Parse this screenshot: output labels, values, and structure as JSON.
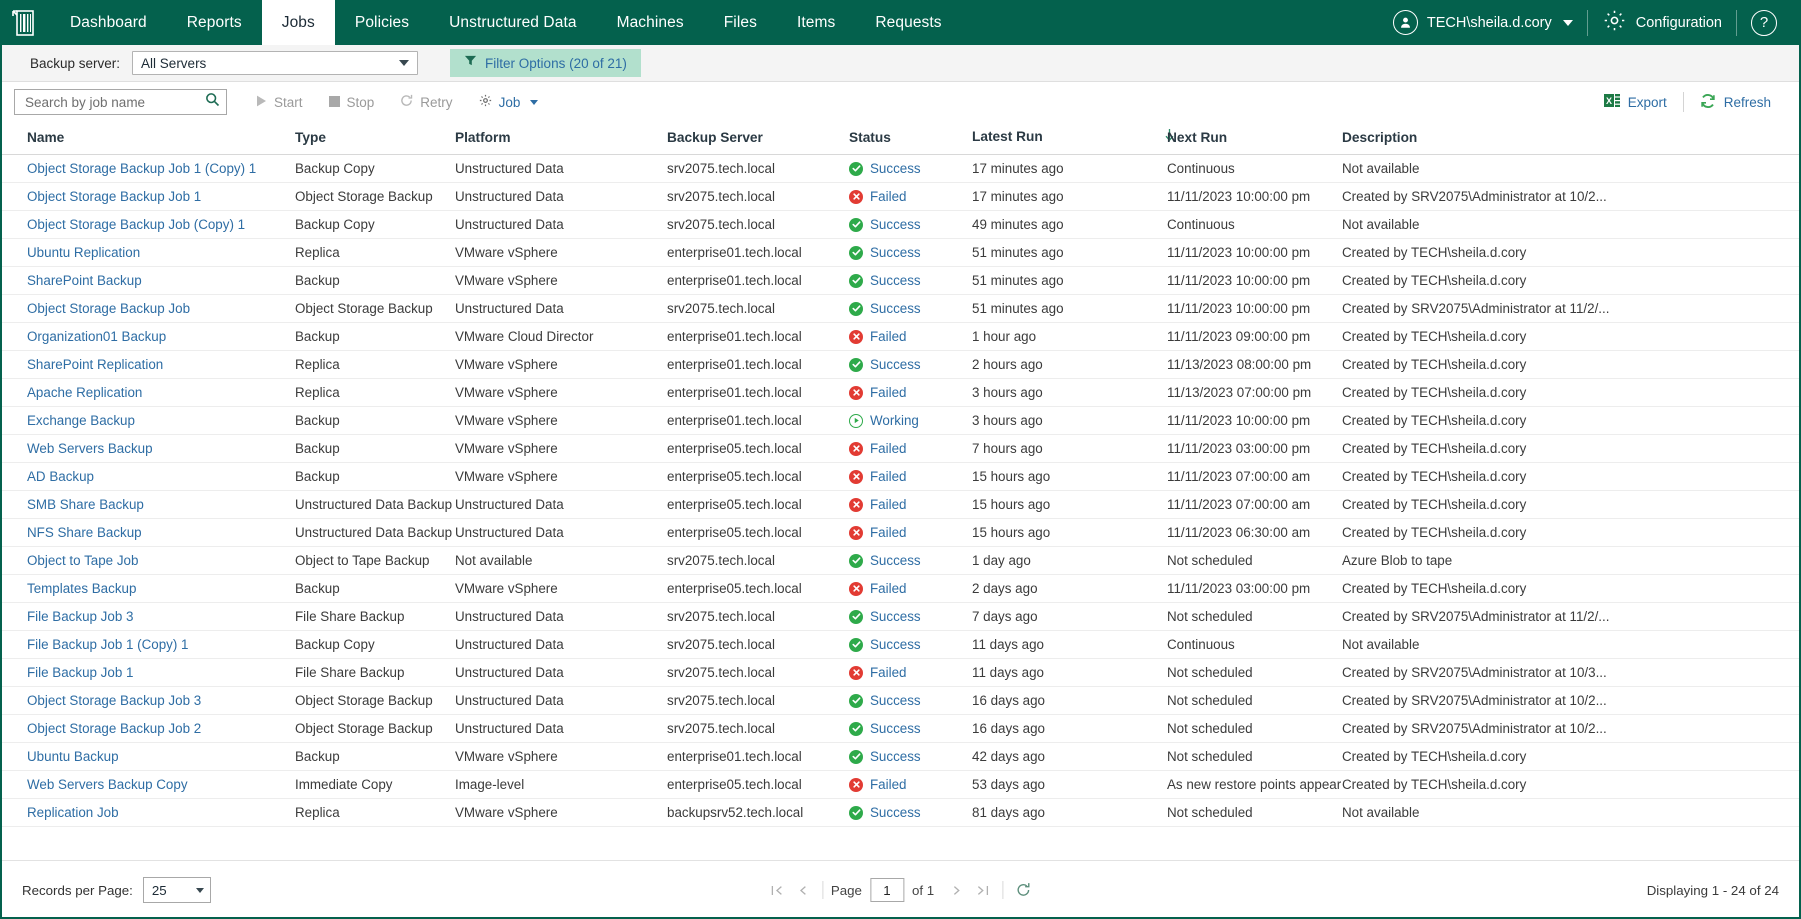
{
  "header": {
    "logo_icon": "barcode-building-icon",
    "nav": [
      {
        "label": "Dashboard",
        "active": false
      },
      {
        "label": "Reports",
        "active": false
      },
      {
        "label": "Jobs",
        "active": true
      },
      {
        "label": "Policies",
        "active": false
      },
      {
        "label": "Unstructured Data",
        "active": false
      },
      {
        "label": "Machines",
        "active": false
      },
      {
        "label": "Files",
        "active": false
      },
      {
        "label": "Items",
        "active": false
      },
      {
        "label": "Requests",
        "active": false
      }
    ],
    "user": "TECH\\sheila.d.cory",
    "configuration": "Configuration",
    "help": "?",
    "accent": "#04614d"
  },
  "filterbar": {
    "backup_server_label": "Backup server:",
    "backup_server_value": "All Servers",
    "filter_options_label": "Filter Options (20 of 21)",
    "filter_chip_bg": "#b2e0cd"
  },
  "actionbar": {
    "search_placeholder": "Search by job name",
    "search_value": "",
    "start": "Start",
    "stop": "Stop",
    "retry": "Retry",
    "job": "Job",
    "export": "Export",
    "refresh": "Refresh"
  },
  "table": {
    "columns": [
      {
        "key": "name",
        "label": "Name"
      },
      {
        "key": "type",
        "label": "Type"
      },
      {
        "key": "platform",
        "label": "Platform"
      },
      {
        "key": "backup_server",
        "label": "Backup Server"
      },
      {
        "key": "status",
        "label": "Status"
      },
      {
        "key": "latest_run",
        "label": "Latest Run"
      },
      {
        "key": "next_run",
        "label": "Next Run"
      },
      {
        "key": "description",
        "label": "Description"
      }
    ],
    "sorted_column": "latest_run",
    "sort_direction": "desc",
    "rows": [
      {
        "name": "Object Storage Backup Job 1 (Copy) 1",
        "type": "Backup Copy",
        "platform": "Unstructured Data",
        "backup_server": "srv2075.tech.local",
        "status": "Success",
        "latest_run": "17 minutes ago",
        "next_run": "Continuous",
        "description": "Not available",
        "desc_muted": true,
        "platform_muted": false
      },
      {
        "name": "Object Storage Backup Job 1",
        "type": "Object Storage Backup",
        "platform": "Unstructured Data",
        "backup_server": "srv2075.tech.local",
        "status": "Failed",
        "latest_run": "17 minutes ago",
        "next_run": "11/11/2023 10:00:00 pm",
        "description": "Created by SRV2075\\Administrator at 10/2...",
        "desc_muted": false,
        "platform_muted": false
      },
      {
        "name": "Object Storage Backup Job (Copy) 1",
        "type": "Backup Copy",
        "platform": "Unstructured Data",
        "backup_server": "srv2075.tech.local",
        "status": "Success",
        "latest_run": "49 minutes ago",
        "next_run": "Continuous",
        "description": "Not available",
        "desc_muted": true,
        "platform_muted": false
      },
      {
        "name": "Ubuntu Replication",
        "type": "Replica",
        "platform": "VMware vSphere",
        "backup_server": "enterprise01.tech.local",
        "status": "Success",
        "latest_run": "51 minutes ago",
        "next_run": "11/11/2023 10:00:00 pm",
        "description": "Created by TECH\\sheila.d.cory",
        "desc_muted": false,
        "platform_muted": false
      },
      {
        "name": "SharePoint Backup",
        "type": "Backup",
        "platform": "VMware vSphere",
        "backup_server": "enterprise01.tech.local",
        "status": "Success",
        "latest_run": "51 minutes ago",
        "next_run": "11/11/2023 10:00:00 pm",
        "description": "Created by TECH\\sheila.d.cory",
        "desc_muted": false,
        "platform_muted": false
      },
      {
        "name": "Object Storage Backup Job",
        "type": "Object Storage Backup",
        "platform": "Unstructured Data",
        "backup_server": "srv2075.tech.local",
        "status": "Success",
        "latest_run": "51 minutes ago",
        "next_run": "11/11/2023 10:00:00 pm",
        "description": "Created by SRV2075\\Administrator at 11/2/...",
        "desc_muted": false,
        "platform_muted": false
      },
      {
        "name": "Organization01 Backup",
        "type": "Backup",
        "platform": "VMware Cloud Director",
        "backup_server": "enterprise01.tech.local",
        "status": "Failed",
        "latest_run": "1 hour ago",
        "next_run": "11/11/2023 09:00:00 pm",
        "description": "Created by TECH\\sheila.d.cory",
        "desc_muted": false,
        "platform_muted": false
      },
      {
        "name": "SharePoint Replication",
        "type": "Replica",
        "platform": "VMware vSphere",
        "backup_server": "enterprise01.tech.local",
        "status": "Success",
        "latest_run": "2 hours ago",
        "next_run": "11/13/2023 08:00:00 pm",
        "description": "Created by TECH\\sheila.d.cory",
        "desc_muted": false,
        "platform_muted": false
      },
      {
        "name": "Apache Replication",
        "type": "Replica",
        "platform": "VMware vSphere",
        "backup_server": "enterprise01.tech.local",
        "status": "Failed",
        "latest_run": "3 hours ago",
        "next_run": "11/13/2023 07:00:00 pm",
        "description": "Created by TECH\\sheila.d.cory",
        "desc_muted": false,
        "platform_muted": false
      },
      {
        "name": "Exchange Backup",
        "type": "Backup",
        "platform": "VMware vSphere",
        "backup_server": "enterprise01.tech.local",
        "status": "Working",
        "latest_run": "3 hours ago",
        "next_run": "11/11/2023 10:00:00 pm",
        "description": "Created by TECH\\sheila.d.cory",
        "desc_muted": false,
        "platform_muted": false
      },
      {
        "name": "Web Servers Backup",
        "type": "Backup",
        "platform": "VMware vSphere",
        "backup_server": "enterprise05.tech.local",
        "status": "Failed",
        "latest_run": "7 hours ago",
        "next_run": "11/11/2023 03:00:00 pm",
        "description": "Created by TECH\\sheila.d.cory",
        "desc_muted": false,
        "platform_muted": false
      },
      {
        "name": "AD Backup",
        "type": "Backup",
        "platform": "VMware vSphere",
        "backup_server": "enterprise05.tech.local",
        "status": "Failed",
        "latest_run": "15 hours ago",
        "next_run": "11/11/2023 07:00:00 am",
        "description": "Created by TECH\\sheila.d.cory",
        "desc_muted": false,
        "platform_muted": false
      },
      {
        "name": "SMB Share Backup",
        "type": "Unstructured Data Backup",
        "platform": "Unstructured Data",
        "backup_server": "enterprise05.tech.local",
        "status": "Failed",
        "latest_run": "15 hours ago",
        "next_run": "11/11/2023 07:00:00 am",
        "description": "Created by TECH\\sheila.d.cory",
        "desc_muted": false,
        "platform_muted": false
      },
      {
        "name": "NFS Share Backup",
        "type": "Unstructured Data Backup",
        "platform": "Unstructured Data",
        "backup_server": "enterprise05.tech.local",
        "status": "Failed",
        "latest_run": "15 hours ago",
        "next_run": "11/11/2023 06:30:00 am",
        "description": "Created by TECH\\sheila.d.cory",
        "desc_muted": false,
        "platform_muted": false
      },
      {
        "name": "Object to Tape Job",
        "type": "Object to Tape Backup",
        "platform": "Not available",
        "backup_server": "srv2075.tech.local",
        "status": "Success",
        "latest_run": "1 day ago",
        "next_run": "Not scheduled",
        "description": "Azure Blob to tape",
        "desc_muted": false,
        "platform_muted": true
      },
      {
        "name": "Templates Backup",
        "type": "Backup",
        "platform": "VMware vSphere",
        "backup_server": "enterprise05.tech.local",
        "status": "Failed",
        "latest_run": "2 days ago",
        "next_run": "11/11/2023 03:00:00 pm",
        "description": "Created by TECH\\sheila.d.cory",
        "desc_muted": false,
        "platform_muted": false
      },
      {
        "name": "File Backup Job 3",
        "type": "File Share Backup",
        "platform": "Unstructured Data",
        "backup_server": "srv2075.tech.local",
        "status": "Success",
        "latest_run": "7 days ago",
        "next_run": "Not scheduled",
        "description": "Created by SRV2075\\Administrator at 11/2/...",
        "desc_muted": false,
        "platform_muted": false
      },
      {
        "name": "File Backup Job 1 (Copy) 1",
        "type": "Backup Copy",
        "platform": "Unstructured Data",
        "backup_server": "srv2075.tech.local",
        "status": "Success",
        "latest_run": "11 days ago",
        "next_run": "Continuous",
        "description": "Not available",
        "desc_muted": true,
        "platform_muted": false
      },
      {
        "name": "File Backup Job 1",
        "type": "File Share Backup",
        "platform": "Unstructured Data",
        "backup_server": "srv2075.tech.local",
        "status": "Failed",
        "latest_run": "11 days ago",
        "next_run": "Not scheduled",
        "description": "Created by SRV2075\\Administrator at 10/3...",
        "desc_muted": false,
        "platform_muted": false
      },
      {
        "name": "Object Storage Backup Job 3",
        "type": "Object Storage Backup",
        "platform": "Unstructured Data",
        "backup_server": "srv2075.tech.local",
        "status": "Success",
        "latest_run": "16 days ago",
        "next_run": "Not scheduled",
        "description": "Created by SRV2075\\Administrator at 10/2...",
        "desc_muted": false,
        "platform_muted": false
      },
      {
        "name": "Object Storage Backup Job 2",
        "type": "Object Storage Backup",
        "platform": "Unstructured Data",
        "backup_server": "srv2075.tech.local",
        "status": "Success",
        "latest_run": "16 days ago",
        "next_run": "Not scheduled",
        "description": "Created by SRV2075\\Administrator at 10/2...",
        "desc_muted": false,
        "platform_muted": false
      },
      {
        "name": "Ubuntu Backup",
        "type": "Backup",
        "platform": "VMware vSphere",
        "backup_server": "enterprise01.tech.local",
        "status": "Success",
        "latest_run": "42 days ago",
        "next_run": "Not scheduled",
        "description": "Created by TECH\\sheila.d.cory",
        "desc_muted": false,
        "platform_muted": false
      },
      {
        "name": "Web Servers Backup Copy",
        "type": "Immediate Copy",
        "platform": "Image-level",
        "backup_server": "enterprise05.tech.local",
        "status": "Failed",
        "latest_run": "53 days ago",
        "next_run": "As new restore points appear",
        "description": "Created by TECH\\sheila.d.cory",
        "desc_muted": false,
        "platform_muted": false
      },
      {
        "name": "Replication Job",
        "type": "Replica",
        "platform": "VMware vSphere",
        "backup_server": "backupsrv52.tech.local",
        "status": "Success",
        "latest_run": "81 days ago",
        "next_run": "Not scheduled",
        "description": "Not available",
        "desc_muted": true,
        "platform_muted": false
      }
    ]
  },
  "footer": {
    "records_per_page_label": "Records per Page:",
    "records_per_page_value": "25",
    "page_label": "Page",
    "page_value": "1",
    "of_label": "of 1",
    "displaying": "Displaying 1 - 24 of 24"
  },
  "colors": {
    "brand_green": "#04614d",
    "link_blue": "#2e6da4",
    "success_green": "#2eaa4a",
    "failed_red": "#e23b33"
  }
}
